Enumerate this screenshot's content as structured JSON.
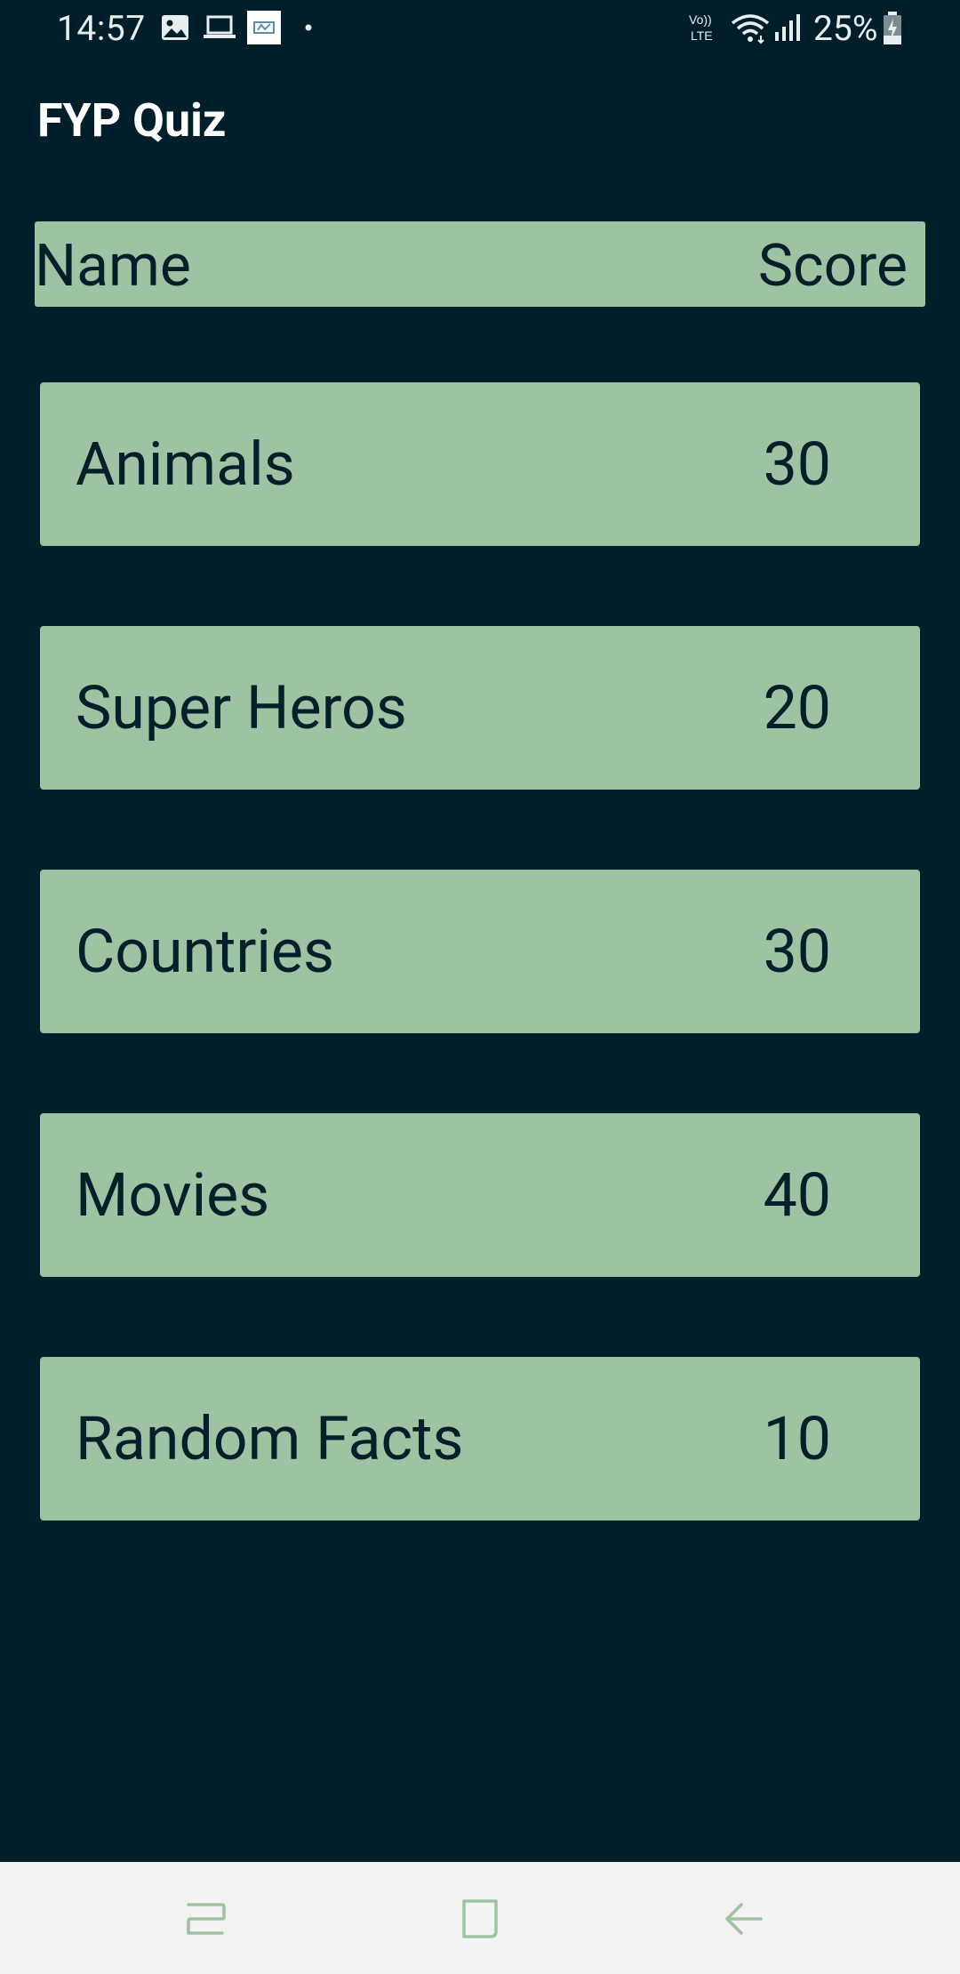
{
  "status_bar": {
    "time": "14:57",
    "battery_percent": "25%",
    "network_label": "Vo)) LTE",
    "icons": [
      "image-icon",
      "laptop-icon",
      "app-notification-icon",
      "dot-icon",
      "volte-icon",
      "wifi-icon",
      "signal-icon",
      "battery-charging-icon"
    ]
  },
  "app_bar": {
    "title": "FYP Quiz"
  },
  "leaderboard": {
    "header": {
      "name": "Name",
      "score": "Score"
    },
    "items": [
      {
        "name": "Animals",
        "score": "30"
      },
      {
        "name": "Super Heros",
        "score": "20"
      },
      {
        "name": "Countries",
        "score": "30"
      },
      {
        "name": "Movies",
        "score": "40"
      },
      {
        "name": "Random Facts",
        "score": "10"
      }
    ]
  },
  "nav_bar": {
    "buttons": [
      "recent-apps-icon",
      "home-icon",
      "back-icon"
    ]
  },
  "colors": {
    "background": "#011f2a",
    "card": "#9ec3a2",
    "card_text": "#021f2a",
    "nav_background": "#f2f2f2",
    "nav_icon": "#9ec3a2"
  }
}
